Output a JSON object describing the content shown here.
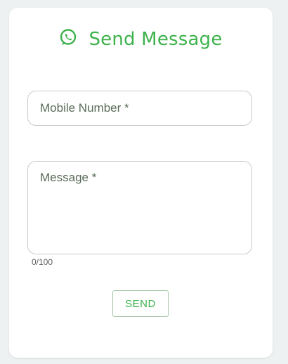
{
  "header": {
    "icon": "whatsapp-icon",
    "title": "Send Message"
  },
  "form": {
    "mobile_label": "Mobile Number *",
    "message_label": "Message *",
    "message_counter": "0/100",
    "send_label": "SEND"
  },
  "colors": {
    "accent": "#3db24b",
    "background": "#eef1f1",
    "card": "#ffffff"
  }
}
